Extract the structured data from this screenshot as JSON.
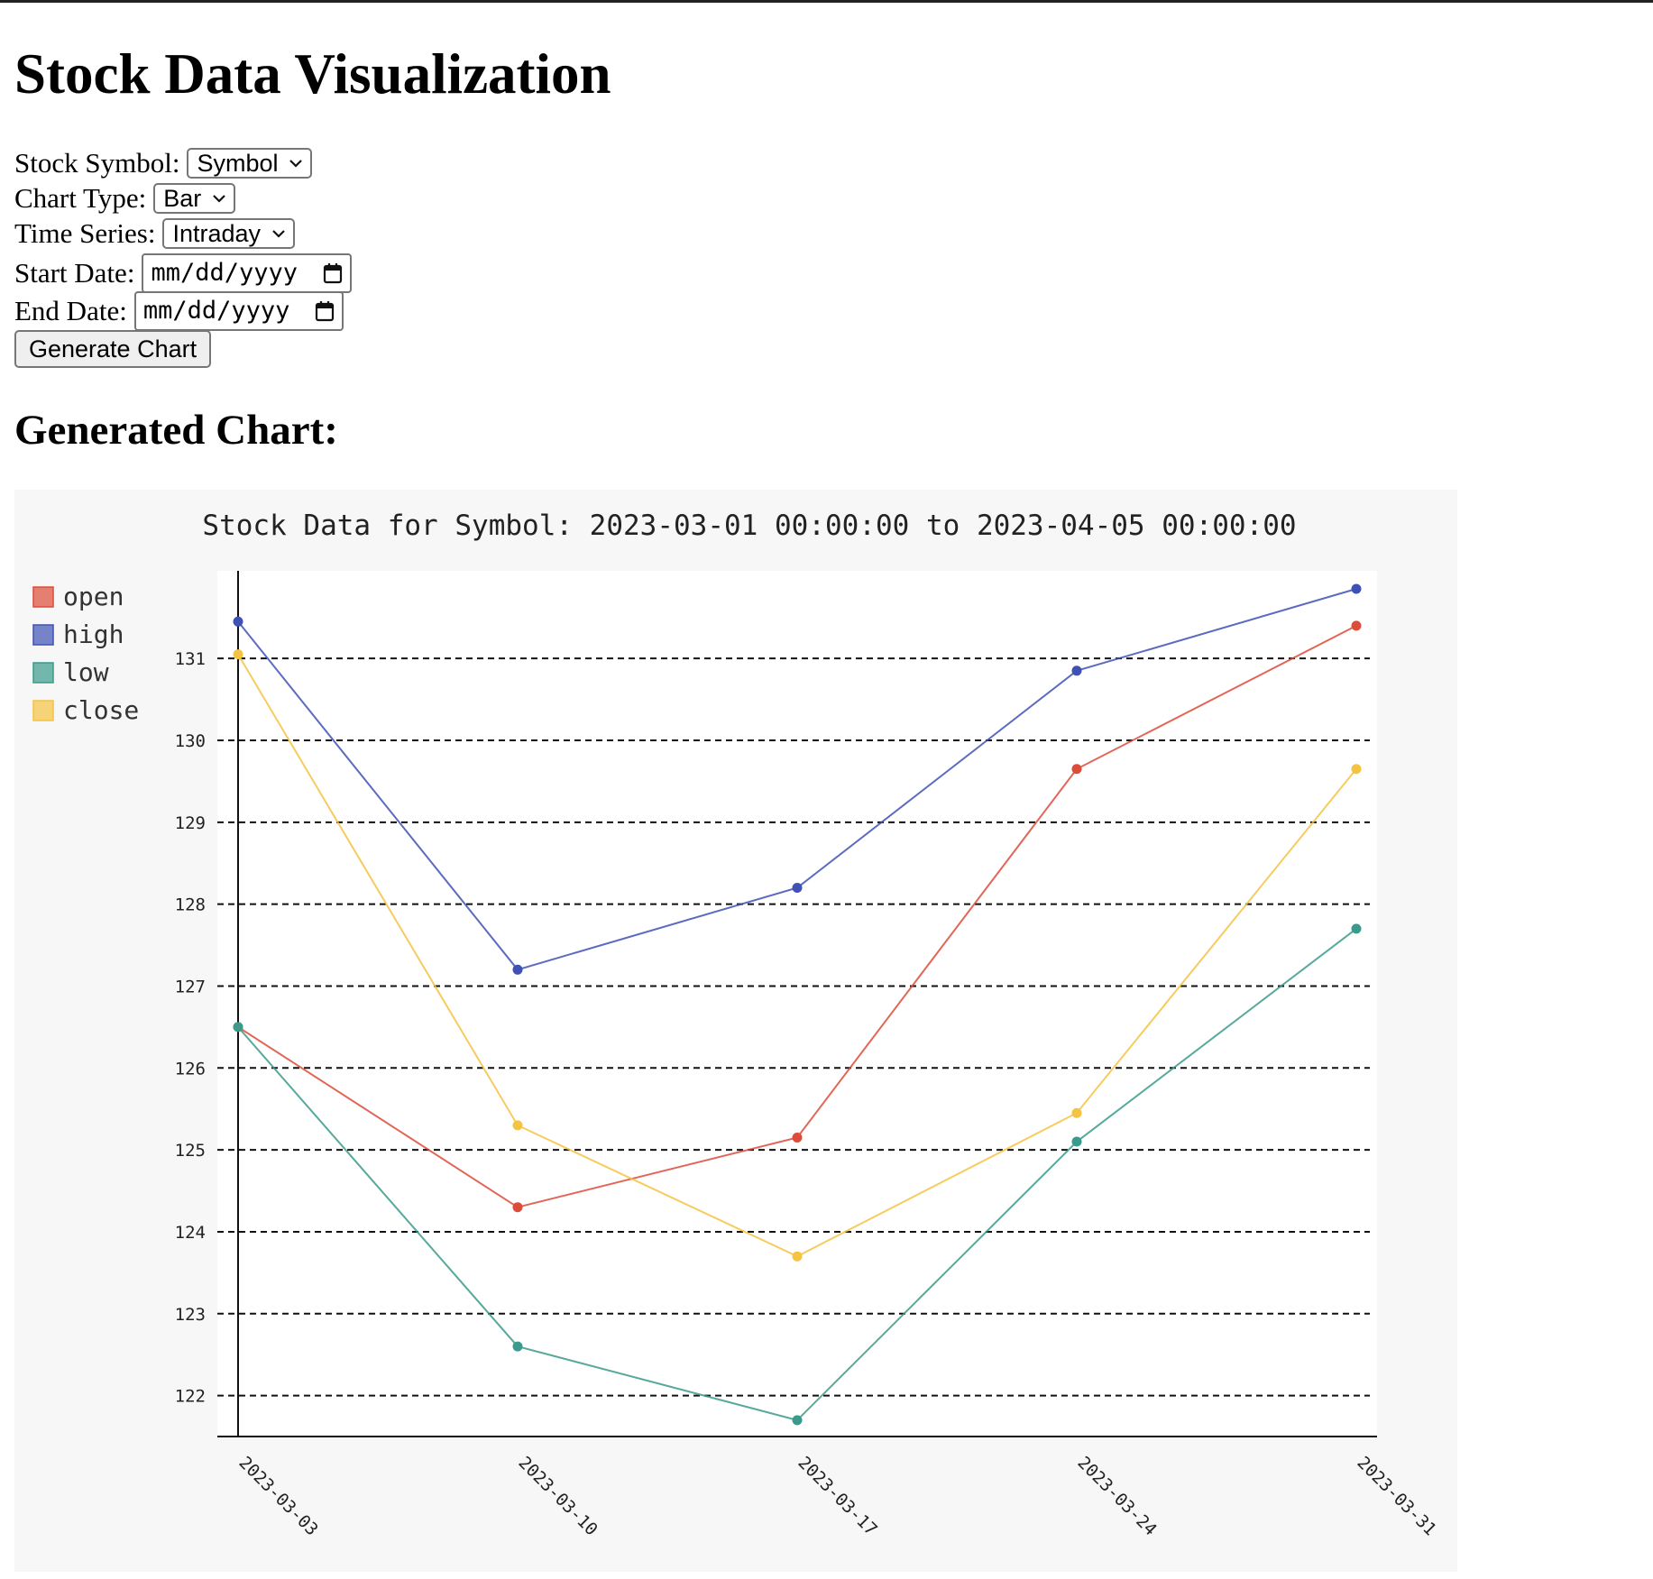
{
  "page": {
    "title": "Stock Data Visualization",
    "section_title": "Generated Chart:"
  },
  "form": {
    "symbol_label": "Stock Symbol:",
    "symbol_value": "Symbol",
    "chart_type_label": "Chart Type:",
    "chart_type_value": "Bar",
    "time_series_label": "Time Series:",
    "time_series_value": "Intraday",
    "start_date_label": "Start Date:",
    "start_date_placeholder": "mm/dd/yyyy",
    "end_date_label": "End Date:",
    "end_date_placeholder": "mm/dd/yyyy",
    "generate_button": "Generate Chart"
  },
  "icons": {
    "select_arrow": "chevron-down-icon",
    "date_picker": "calendar-icon"
  },
  "chart_data": {
    "type": "line",
    "title": "Stock Data for Symbol: 2023-03-01 00:00:00 to 2023-04-05 00:00:00",
    "xlabel": "",
    "ylabel": "",
    "categories": [
      "2023-03-03",
      "2023-03-10",
      "2023-03-17",
      "2023-03-24",
      "2023-03-31"
    ],
    "yticks": [
      122,
      123,
      124,
      125,
      126,
      127,
      128,
      129,
      130,
      131
    ],
    "ylim": [
      121.5,
      132.07
    ],
    "grid": "horizontal dashed",
    "legend_position": "left",
    "series": [
      {
        "name": "open",
        "color": "#dd4b39",
        "values": [
          126.5,
          124.3,
          125.15,
          129.65,
          131.4
        ]
      },
      {
        "name": "high",
        "color": "#3f51b5",
        "values": [
          131.45,
          127.2,
          128.2,
          130.85,
          131.85
        ]
      },
      {
        "name": "low",
        "color": "#3a9a8b",
        "values": [
          126.5,
          122.6,
          121.7,
          125.1,
          127.7
        ]
      },
      {
        "name": "close",
        "color": "#f5c342",
        "values": [
          131.05,
          125.3,
          123.7,
          125.45,
          129.65
        ]
      }
    ]
  }
}
